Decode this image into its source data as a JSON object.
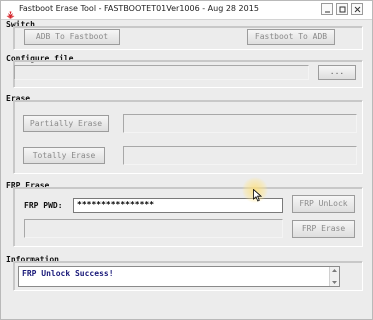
{
  "window": {
    "title": "Fastboot Erase Tool - FASTBOOTET01Ver1006 - Aug 28 2015",
    "icon": "huawei-logo-icon",
    "controls": [
      "minimize-icon",
      "maximize-icon",
      "close-icon"
    ]
  },
  "switch": {
    "label": "Switch",
    "adb_to_fastboot": "ADB To Fastboot",
    "fastboot_to_adb": "Fastboot To ADB"
  },
  "configure": {
    "label": "Configure file",
    "browse": "..."
  },
  "erase": {
    "label": "Erase",
    "partially": "Partially Erase",
    "totally": "Totally Erase"
  },
  "frp": {
    "label": "FRP Erase",
    "pwd_label": "FRP PWD:",
    "pwd_value": "****************",
    "unlock": "FRP UnLock",
    "erase": "FRP Erase"
  },
  "information": {
    "label": "Information",
    "message": "FRP Unlock Success!"
  },
  "colors": {
    "accent": "#d2232a",
    "info_text": "#1a1a7a",
    "disabled_text": "#8a8a8a"
  }
}
